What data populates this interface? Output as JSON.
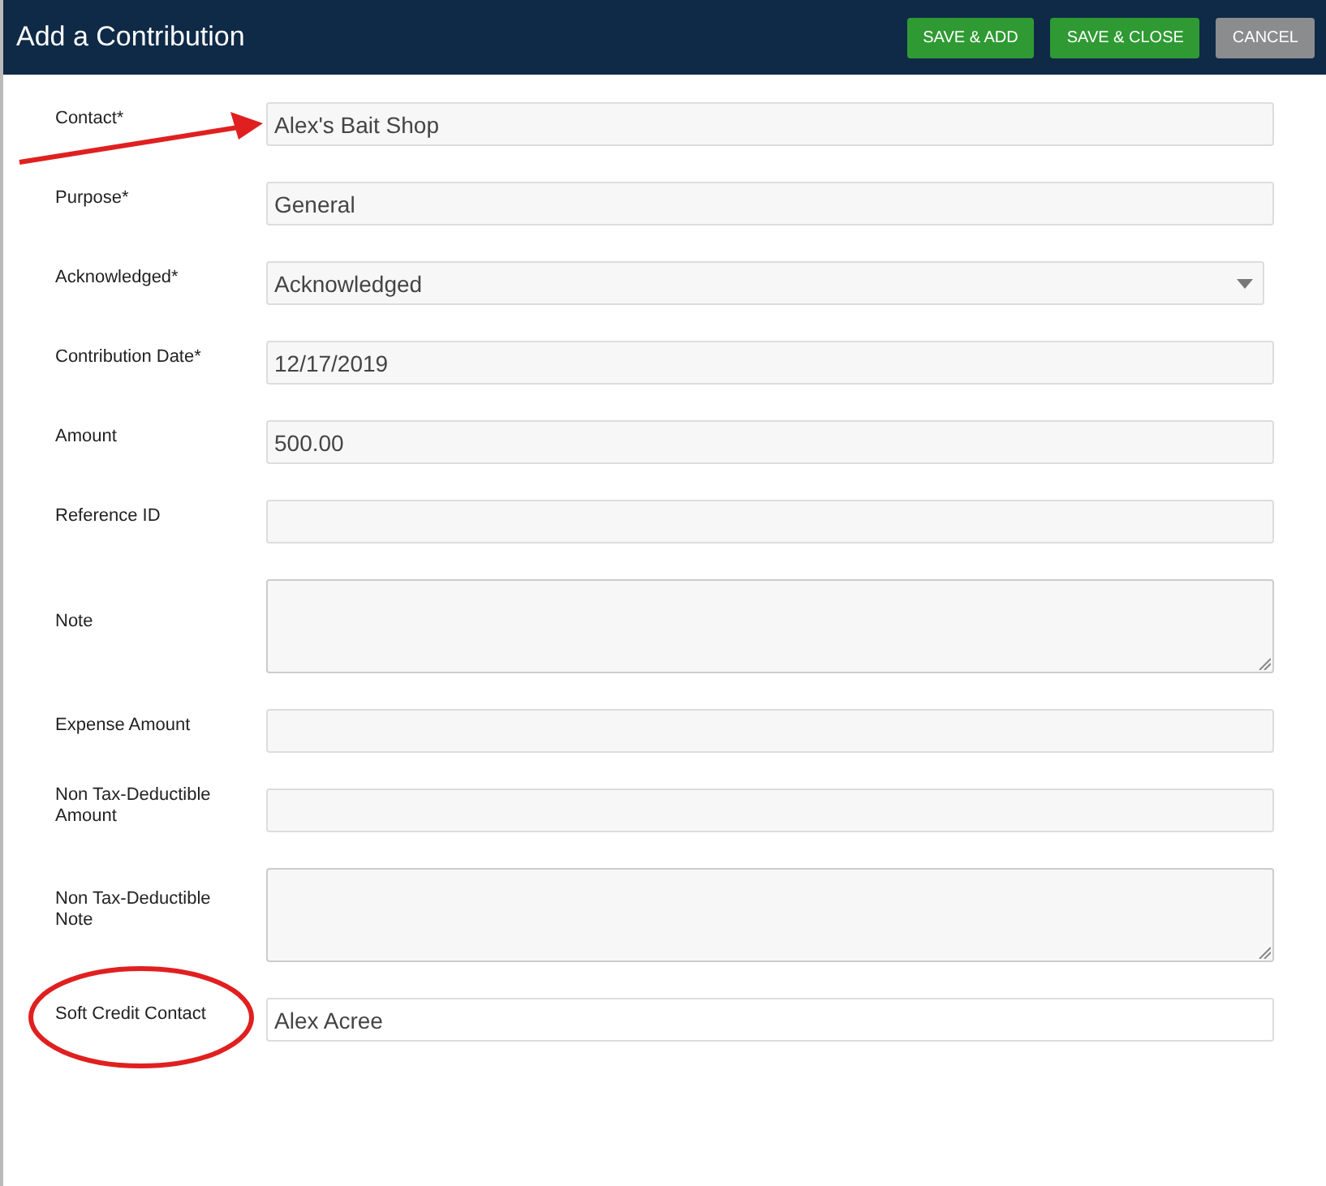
{
  "window": {
    "title": "Add a Contribution"
  },
  "buttons": [
    {
      "label": "SAVE & ADD",
      "kind": "primary"
    },
    {
      "label": "SAVE & CLOSE",
      "kind": "primary"
    },
    {
      "label": "CANCEL",
      "kind": "secondary"
    }
  ],
  "fields": [
    {
      "label": "Contact*",
      "kind": "text",
      "value": "Alex's Bait Shop"
    },
    {
      "label": "Purpose*",
      "kind": "text",
      "value": "General"
    },
    {
      "label": "Acknowledged*",
      "kind": "select",
      "value": "Acknowledged"
    },
    {
      "label": "Contribution Date*",
      "kind": "text",
      "value": "12/17/2019"
    },
    {
      "label": "Amount",
      "kind": "text",
      "value": "500.00"
    },
    {
      "label": "Reference ID",
      "kind": "text"
    },
    {
      "label": "Note",
      "kind": "textarea"
    },
    {
      "label": "Expense Amount",
      "kind": "text"
    },
    {
      "label": "Non Tax-Deductible Amount",
      "kind": "text"
    },
    {
      "label": "Non Tax-Deductible Note",
      "kind": "textarea"
    },
    {
      "label": "Soft Credit Contact",
      "kind": "lookup",
      "value": "Alex  Acree"
    }
  ]
}
